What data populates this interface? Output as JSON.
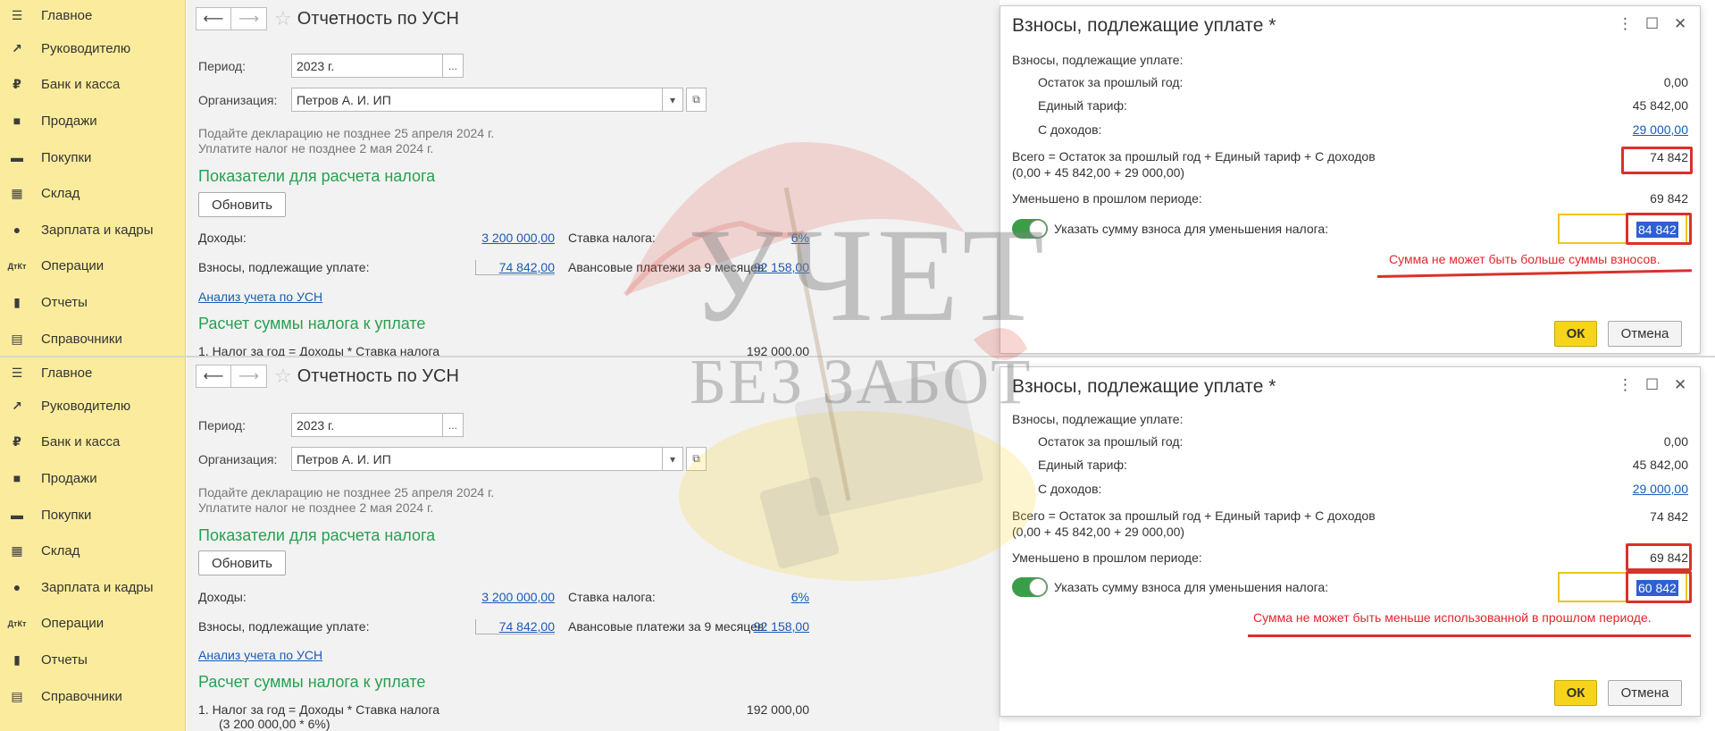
{
  "sidebar": {
    "items": [
      {
        "label": "Главное",
        "icon": "menu-icon"
      },
      {
        "label": "Руководителю",
        "icon": "trend-icon"
      },
      {
        "label": "Банк и касса",
        "icon": "ruble-icon"
      },
      {
        "label": "Продажи",
        "icon": "bag-icon"
      },
      {
        "label": "Покупки",
        "icon": "cart-icon"
      },
      {
        "label": "Склад",
        "icon": "grid-icon"
      },
      {
        "label": "Зарплата и кадры",
        "icon": "person-icon"
      },
      {
        "label": "Операции",
        "icon": "dt-kt-icon"
      },
      {
        "label": "Отчеты",
        "icon": "bar-chart-icon"
      },
      {
        "label": "Справочники",
        "icon": "book-icon"
      }
    ]
  },
  "report": {
    "title": "Отчетность по УСН",
    "period_label": "Период:",
    "period_value": "2023 г.",
    "org_label": "Организация:",
    "org_value": "Петров А. И. ИП",
    "note1": "Подайте декларацию не позднее 25 апреля 2024 г.",
    "note2": "Уплатите налог не позднее 2 мая 2024 г.",
    "indicators_title": "Показатели для расчета налога",
    "refresh_label": "Обновить",
    "income_label": "Доходы:",
    "income_value": "3 200 000,00",
    "rate_label": "Ставка налога:",
    "rate_value": "6%",
    "contrib_label": "Взносы, подлежащие уплате:",
    "contrib_value": "74 842,00",
    "advance_label": "Авансовые платежи за 9 месяцев:",
    "advance_value": "92 158,00",
    "analysis_link": "Анализ учета по УСН",
    "calc_title": "Расчет суммы налога к уплате",
    "calc_line1": "1.  Налог за год = Доходы * Ставка налога",
    "calc_line1_value": "192 000,00",
    "calc_line2": "(3 200 000,00 * 6%)"
  },
  "dialog": {
    "title": "Взносы, подлежащие уплате *",
    "header": "Взносы, подлежащие уплате:",
    "prev_balance_label": "Остаток за прошлый год:",
    "prev_balance_value": "0,00",
    "tariff_label": "Единый тариф:",
    "tariff_value": "45 842,00",
    "income_label": "С доходов:",
    "income_value": "29 000,00",
    "total_label": "Всего = Остаток за прошлый год + Единый тариф + С доходов",
    "total_formula": "(0,00 + 45 842,00 + 29 000,00)",
    "total_value": "74 842",
    "reduced_label": "Уменьшено в прошлом периоде:",
    "reduced_value": "69 842",
    "specify_label": "Указать сумму взноса для уменьшения налога:",
    "ok_label": "ОК",
    "cancel_label": "Отмена"
  },
  "cases": {
    "top": {
      "input_value": "84 842",
      "error": "Сумма не может быть больше суммы взносов."
    },
    "bottom": {
      "input_value": "60 842",
      "error": "Сумма не может быть меньше использованной в прошлом периоде."
    }
  },
  "watermark": {
    "line1": "УЧЕТ",
    "line2": "БЕЗ ЗАБОТ"
  },
  "colors": {
    "sidebar_bg": "#fbec9d",
    "section_green": "#28a050",
    "link_blue": "#1a5bb5",
    "error_red": "#e0262c",
    "ok_yellow": "#f5d41b",
    "toggle_green": "#3a9e48"
  }
}
